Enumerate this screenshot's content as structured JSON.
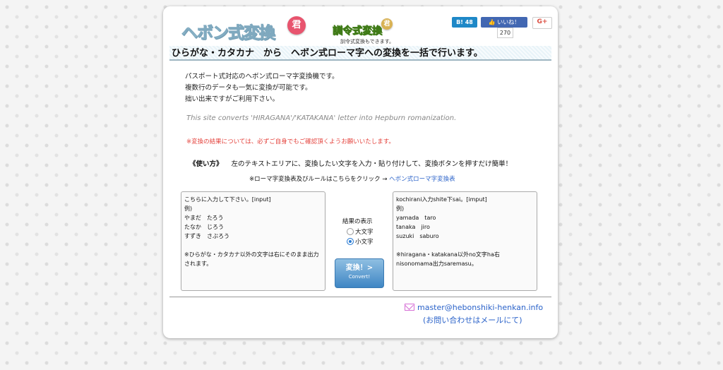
{
  "header": {
    "logo_main": "ヘボン式変換",
    "logo_badge": "君",
    "logo_sub": "訓令式変換",
    "logo_sub_badge": "君",
    "logo_sub_note": "訓令式変換もできます。"
  },
  "social": {
    "hatena_label": "B! 48",
    "facebook_label": "いいね！",
    "facebook_count": "270",
    "gplus_label": "G+"
  },
  "headline": "ひらがな・カタカナ　から　ヘボン式ローマ字への変換を一括で行います。",
  "description": [
    "パスポート式対応のヘボン式ローマ字変換機です。",
    "複数行のデータも一気に変換が可能です。",
    "拙い出来ですがご利用下さい。"
  ],
  "english_note": "This site converts 'HIRAGANA'/'KATAKANA' letter into Hepburn romanization.",
  "warning": "※変換の結果については、必ずご自身でもご確認頂くようお願いいたします。",
  "howto": {
    "title": "《使い方》",
    "text": "左のテキストエリアに、変換したい文字を入力・貼り付けして、変換ボタンを押すだけ簡単！"
  },
  "rules": {
    "text": "※ローマ字変換表及びルールはこちらをクリック → ",
    "link": "ヘボン式ローマ字変換表"
  },
  "input_box": "こちらに入力して下さい。[input]\n例)\nやまだ　たろう\nたなか　じろう\nすずき　さぶろう\n\n※ひらがな・カタカナ以外の文字は右にそのまま出力されます。",
  "output_box": "kochirani入力shite下sai。[imput]\n例)\nyamada　taro\ntanaka　jiro\nsuzuki　saburo\n\n※hiragana・katakana以外no文字ha右nisonomama出力saremasu。",
  "result_display": {
    "label": "結果の表示",
    "option_upper": "大文字",
    "option_lower": "小文字",
    "selected": "小文字"
  },
  "convert_button": {
    "label": "変換！>",
    "sub": "Convert!"
  },
  "contact": {
    "email": "master@hebonshiki-henkan.info",
    "note": "(お問い合わせはメールにて)"
  }
}
